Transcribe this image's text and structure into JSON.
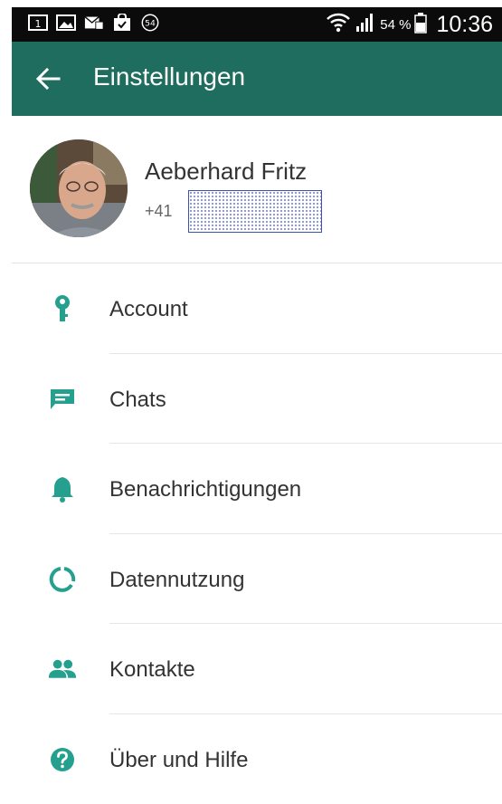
{
  "status_bar": {
    "battery_percent": "54 %",
    "time": "10:36",
    "notification_badge": "54"
  },
  "toolbar": {
    "title": "Einstellungen"
  },
  "profile": {
    "name": "Aeberhard Fritz",
    "phone_prefix": "+41"
  },
  "menu": {
    "items": [
      {
        "label": "Account",
        "icon": "key-icon"
      },
      {
        "label": "Chats",
        "icon": "chat-icon"
      },
      {
        "label": "Benachrichtigungen",
        "icon": "bell-icon"
      },
      {
        "label": "Datennutzung",
        "icon": "data-usage-icon"
      },
      {
        "label": "Kontakte",
        "icon": "contacts-icon"
      },
      {
        "label": "Über und Hilfe",
        "icon": "help-icon"
      }
    ]
  },
  "colors": {
    "toolbar": "#1f6d5e",
    "accent": "#25a08f"
  }
}
